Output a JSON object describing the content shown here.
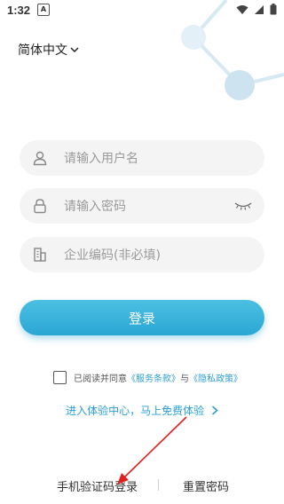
{
  "status_bar": {
    "time": "1:32",
    "notification_icon": "A"
  },
  "language_selector": {
    "label": "简体中文"
  },
  "username": {
    "placeholder": "请输入用户名"
  },
  "password": {
    "placeholder": "请输入密码"
  },
  "company_code": {
    "placeholder": "企业编码(非必填)"
  },
  "login_button": {
    "label": "登录"
  },
  "agreement": {
    "prefix": "已阅读并同意",
    "terms": "《服务条款》",
    "conjunction": "与",
    "privacy": "《隐私政策》"
  },
  "experience_link": {
    "label": "进入体验中心，马上免费体验"
  },
  "bottom_links": {
    "sms_login": "手机验证码登录",
    "reset_password": "重置密码"
  },
  "colors": {
    "accent": "#2aa6d4",
    "link": "#2a9fd6",
    "annotation_arrow": "#e02020"
  }
}
